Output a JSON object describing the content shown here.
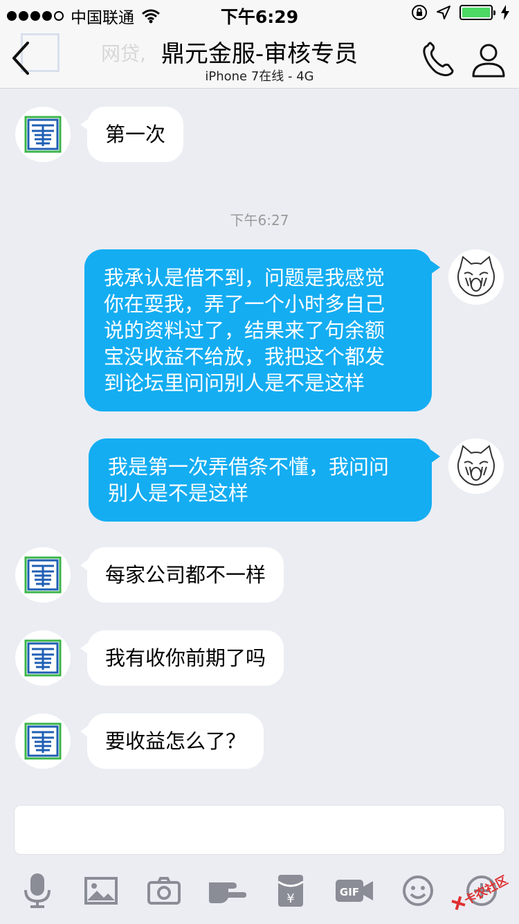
{
  "status_bar": {
    "carrier": "中国联通",
    "time": "下午6:29"
  },
  "nav": {
    "back_icon": "chevron-left-icon",
    "title": "鼎元金服-审核专员",
    "subtitle": "iPhone 7在线 - 4G",
    "ghost_text": "网贷,",
    "call_icon": "phone-icon",
    "profile_icon": "person-icon"
  },
  "chat": {
    "timestamp": "下午6:27",
    "messages": [
      {
        "side": "in",
        "text": "第一次"
      },
      {
        "side": "out",
        "lines": [
          "我承认是借不到，问题是我感觉",
          "你在耍我，弄了一个小时多自己",
          "说的资料过了，结果来了句余额",
          "宝没收益不给放，我把这个都发",
          "到论坛里问问别人是不是这样"
        ]
      },
      {
        "side": "out",
        "lines": [
          "我是第一次弄借条不懂，我问问",
          "别人是不是这样"
        ]
      },
      {
        "side": "in",
        "text": "每家公司都不一样"
      },
      {
        "side": "in",
        "text": "我有收你前期了吗"
      },
      {
        "side": "in",
        "text": "要收益怎么了？"
      }
    ]
  },
  "input": {
    "value": ""
  },
  "toolbar": {
    "icons": [
      "microphone-icon",
      "image-icon",
      "camera-icon",
      "poke-hand-icon",
      "red-packet-icon",
      "gif-icon",
      "emoji-icon",
      "plus-icon"
    ],
    "gif_label": "GIF"
  },
  "watermark": {
    "text": "卡农社区"
  },
  "colors": {
    "out_bubble": "#14adf2",
    "background": "#ebedf3",
    "battery": "#4cd964"
  }
}
